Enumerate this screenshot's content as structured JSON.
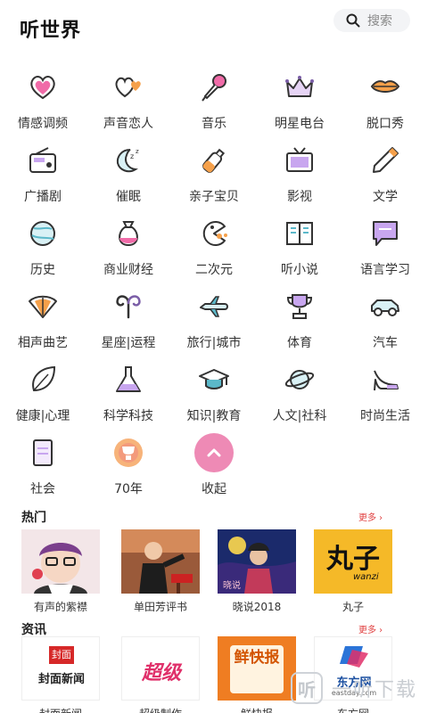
{
  "header": {
    "title": "听世界",
    "search_placeholder": "搜索"
  },
  "categories": [
    {
      "label": "情感调频",
      "icon": "heart-icon"
    },
    {
      "label": "声音恋人",
      "icon": "hearts-icon"
    },
    {
      "label": "音乐",
      "icon": "microphone-icon"
    },
    {
      "label": "明星电台",
      "icon": "crown-icon"
    },
    {
      "label": "脱口秀",
      "icon": "lips-icon"
    },
    {
      "label": "广播剧",
      "icon": "radio-icon"
    },
    {
      "label": "催眠",
      "icon": "moon-icon"
    },
    {
      "label": "亲子宝贝",
      "icon": "baby-bottle-icon"
    },
    {
      "label": "影视",
      "icon": "tv-icon"
    },
    {
      "label": "文学",
      "icon": "pencil-icon"
    },
    {
      "label": "历史",
      "icon": "globe-icon"
    },
    {
      "label": "商业财经",
      "icon": "money-bag-icon"
    },
    {
      "label": "二次元",
      "icon": "pacman-icon"
    },
    {
      "label": "听小说",
      "icon": "book-icon"
    },
    {
      "label": "语言学习",
      "icon": "chat-bubble-icon"
    },
    {
      "label": "相声曲艺",
      "icon": "fan-icon"
    },
    {
      "label": "星座|运程",
      "icon": "aries-icon"
    },
    {
      "label": "旅行|城市",
      "icon": "airplane-icon"
    },
    {
      "label": "体育",
      "icon": "trophy-icon"
    },
    {
      "label": "汽车",
      "icon": "car-icon"
    },
    {
      "label": "健康|心理",
      "icon": "leaf-icon"
    },
    {
      "label": "科学科技",
      "icon": "flask-icon"
    },
    {
      "label": "知识|教育",
      "icon": "graduation-cap-icon"
    },
    {
      "label": "人文|社科",
      "icon": "planet-icon"
    },
    {
      "label": "时尚生活",
      "icon": "high-heel-icon"
    },
    {
      "label": "社会",
      "icon": "document-icon"
    },
    {
      "label": "70年",
      "icon": "anniversary-badge-icon"
    },
    {
      "label": "收起",
      "icon": "chevron-up-icon"
    }
  ],
  "hot": {
    "title": "热门",
    "more": "更多 ›",
    "items": [
      {
        "caption": "有声的紫襟",
        "thumb": "cartoon-avatar"
      },
      {
        "caption": "单田芳评书",
        "thumb": "storyteller-photo"
      },
      {
        "caption": "晓说2018",
        "thumb": "xiaoshuo-poster"
      },
      {
        "caption": "丸子",
        "thumb": "wanzi-logo",
        "logo_text": "丸子",
        "logo_sub": "wanzi"
      }
    ]
  },
  "news": {
    "title": "资讯",
    "more": "更多 ›",
    "items": [
      {
        "caption": "封面新闻",
        "logo_text": "封面新闻",
        "logo_badge": "封面"
      },
      {
        "caption": "超级制作",
        "logo_text": "超级"
      },
      {
        "caption": "鲜快报",
        "logo_text": "鲜快报"
      },
      {
        "caption": "东方网",
        "logo_text": "东方网",
        "logo_sub": "eastday.com"
      }
    ]
  },
  "watermark": {
    "icon_char": "听",
    "text": "一听下载"
  },
  "colors": {
    "accent_pink": "#ee8ab5",
    "accent_purple": "#7b5ea7",
    "accent_teal": "#5bb8c9",
    "more_red": "#e04040"
  }
}
